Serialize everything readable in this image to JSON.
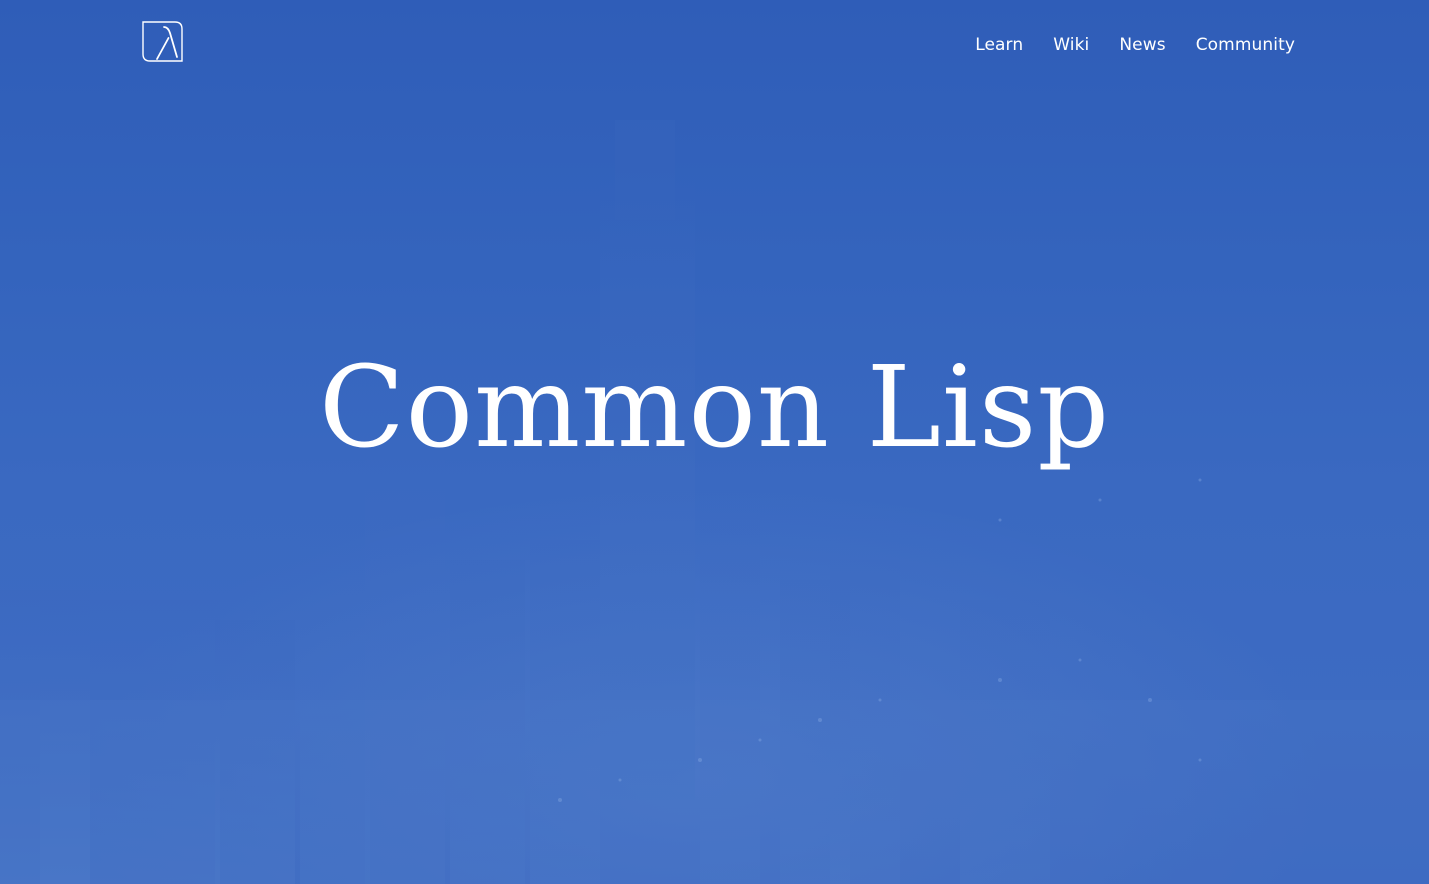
{
  "header": {
    "logo_name": "lambda-logo",
    "nav": [
      {
        "label": "Learn"
      },
      {
        "label": "Wiki"
      },
      {
        "label": "News"
      },
      {
        "label": "Community"
      }
    ]
  },
  "hero": {
    "title": "Common Lisp",
    "background_description_color": "#3564bf"
  },
  "colors": {
    "overlay_blue": "#3564bf",
    "text": "#ffffff"
  }
}
